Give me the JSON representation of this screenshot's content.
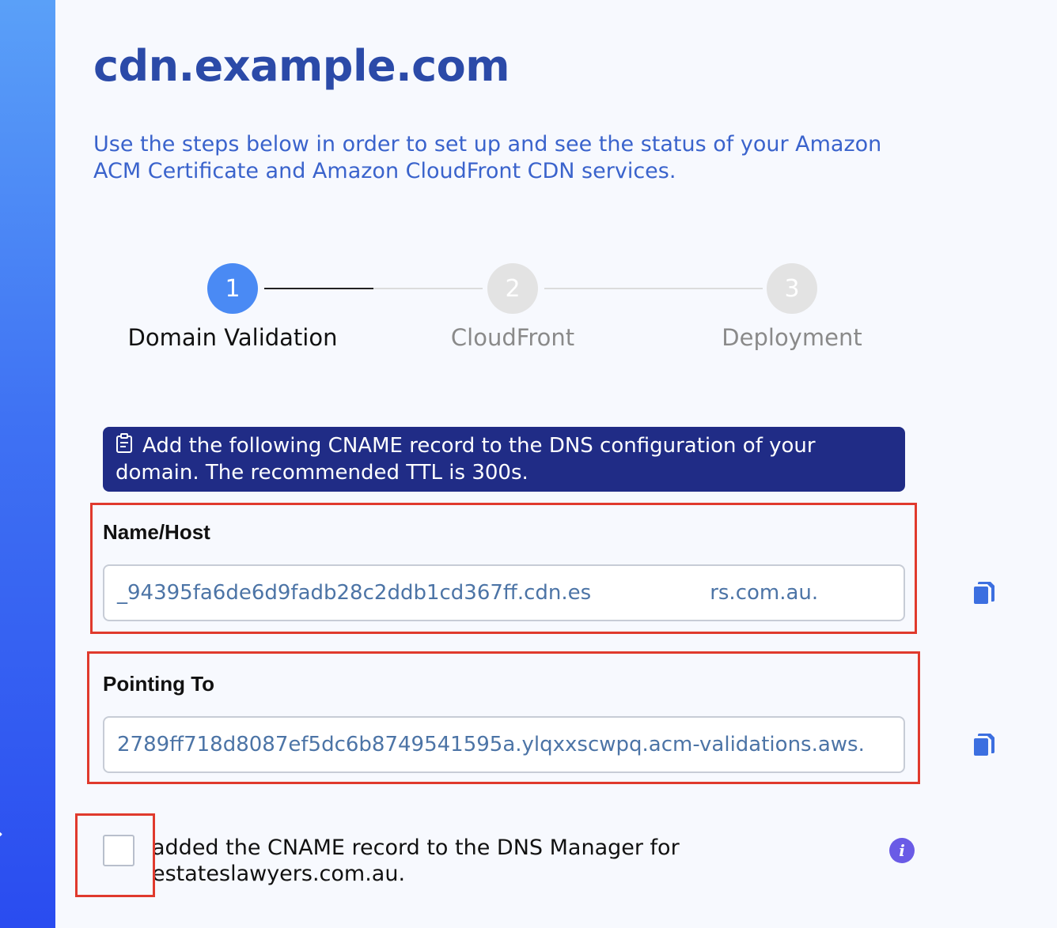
{
  "page": {
    "title": "cdn.example.com",
    "intro": "Use the steps below in order to set up and see the status of your Amazon ACM Certificate and Amazon CloudFront CDN services."
  },
  "steps": [
    {
      "number": "1",
      "label": "Domain Validation",
      "state": "active"
    },
    {
      "number": "2",
      "label": "CloudFront",
      "state": "inactive"
    },
    {
      "number": "3",
      "label": "Deployment",
      "state": "inactive"
    }
  ],
  "banner": {
    "icon": "clipboard-icon",
    "text": "Add the following CNAME record to the DNS configuration of your domain. The recommended TTL is 300s."
  },
  "fields": {
    "name_host": {
      "label": "Name/Host",
      "value_start": "_94395fa6de6d9fadb28c2ddb1cd367ff.cdn.es",
      "value_end": "rs.com.au."
    },
    "pointing_to": {
      "label": "Pointing To",
      "value": "2789ff718d8087ef5dc6b8749541595a.ylqxxscwpq.acm-validations.aws."
    }
  },
  "confirm": {
    "text": "added the CNAME record to the DNS Manager for estateslawyers.com.au.",
    "checked": false
  },
  "icons": {
    "copy": "copy-icon",
    "info": "info-icon",
    "sidebar": "chevron-icon"
  },
  "colors": {
    "title": "#2b4aa8",
    "intro": "#3a63cc",
    "active_step": "#4a8af4",
    "inactive_step": "#e3e3e3",
    "banner_bg": "#202c86",
    "highlight_box": "#e03a2d",
    "field_text": "#4c74a6",
    "copy_icon": "#3c6fe0",
    "info_icon": "#6a5be6"
  }
}
